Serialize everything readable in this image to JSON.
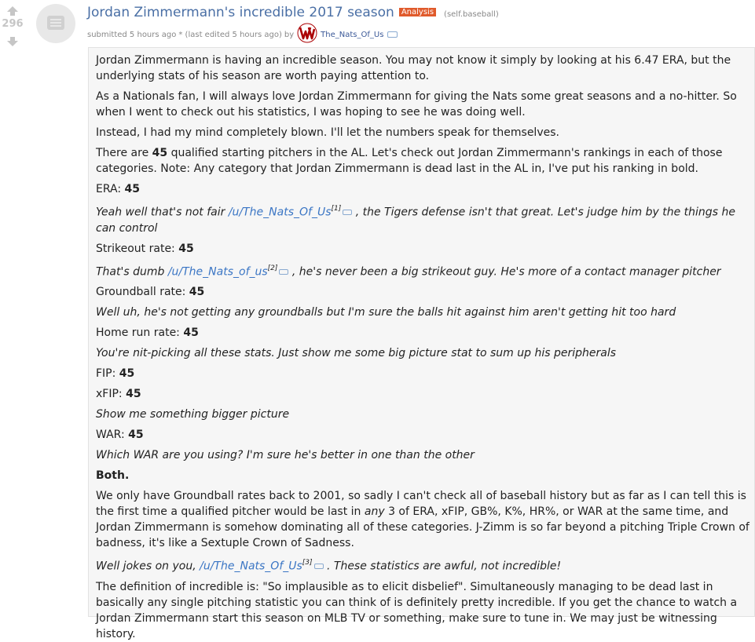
{
  "post": {
    "score": "296",
    "title": "Jordan Zimmermann's incredible 2017 season",
    "flair": "Analysis",
    "domain": "(self.baseball)",
    "submitted": "submitted 5 hours ago",
    "edited": "* (last edited 5 hours ago)",
    "by": "by",
    "author": "The_Nats_Of_Us"
  },
  "body": {
    "p1": "Jordan Zimmermann is having an incredible season. You may not know it simply by looking at his 6.47 ERA, but the underlying stats of his season are worth paying attention to.",
    "p2": "As a Nationals fan, I will always love Jordan Zimmermann for giving the Nats some great seasons and a no-hitter. So when I went to check out his statistics, I was hoping to see he was doing well.",
    "p3": "Instead, I had my mind completely blown. I'll let the numbers speak for themselves.",
    "p4_a": "There are ",
    "p4_b": "45",
    "p4_c": " qualified starting pitchers in the AL. Let's check out Jordan Zimmermann's rankings in each of those categories. Note: Any category that Jordan Zimmermann is dead last in the AL in, I've put his ranking in bold.",
    "era_label": "ERA: ",
    "era_val": "45",
    "q1_a": "Yeah well that's not fair ",
    "q1_link": "/u/The_Nats_Of_Us",
    "q1_sup": "[1]",
    "q1_b": " , the Tigers defense isn't that great. Let's judge him by the things he can control",
    "k_label": "Strikeout rate: ",
    "k_val": "45",
    "q2_a": "That's dumb ",
    "q2_link": "/u/The_Nats_of_us",
    "q2_sup": "[2]",
    "q2_b": " , he's never been a big strikeout guy. He's more of a contact manager pitcher",
    "gb_label": "Groundball rate: ",
    "gb_val": "45",
    "q3": "Well uh, he's not getting any groundballs but I'm sure the balls hit against him aren't getting hit too hard",
    "hr_label": "Home run rate: ",
    "hr_val": "45",
    "q4": "You're nit-picking all these stats. Just show me some big picture stat to sum up his peripherals",
    "fip_label": "FIP: ",
    "fip_val": "45",
    "xfip_label": "xFIP: ",
    "xfip_val": "45",
    "q5": "Show me something bigger picture",
    "war_label": "WAR: ",
    "war_val": "45",
    "q6": "Which WAR are you using? I'm sure he's better in one than the other",
    "both": "Both.",
    "p5_a": "We only have Groundball rates back to 2001, so sadly I can't check all of baseball history but as far as I can tell this is the first time a qualified pitcher would be last in ",
    "p5_any": "any",
    "p5_b": " 3 of ERA, xFIP, GB%, K%, HR%, or WAR at the same time, and Jordan Zimmermann is somehow dominating all of these categories. J-Zimm is so far beyond a pitching Triple Crown of badness, it's like a Sextuple Crown of Sadness.",
    "q7_a": "Well jokes on you, ",
    "q7_link": "/u/The_Nats_Of_Us",
    "q7_sup": "[3]",
    "q7_b": " . These statistics are awful, not incredible!",
    "p6": "The definition of incredible is: \"So implausible as to elicit disbelief\". Simultaneously managing to be dead last in basically any single pitching statistic you can think of is definitely pretty incredible. If you get the chance to watch a Jordan Zimmermann start this season on MLB TV or something, make sure to tune in. We may just be witnessing history."
  },
  "colors": {
    "title": "#4a6fa5",
    "flair_bg": "#e05a2b",
    "link": "#3a75c4",
    "nationals_red": "#ab0003"
  }
}
